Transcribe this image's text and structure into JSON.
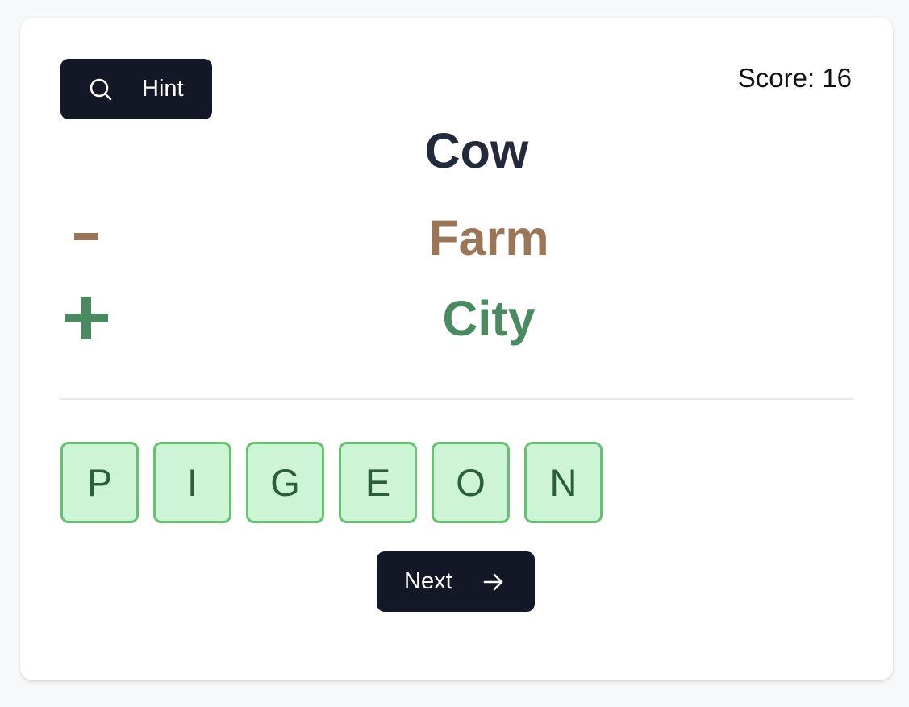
{
  "hint": {
    "label": "Hint",
    "icon": "search-icon"
  },
  "score": {
    "text": "Score: 16"
  },
  "puzzle": {
    "base_word": "Cow",
    "minus": {
      "sign": "-",
      "word": "Farm",
      "color": "#9a7657"
    },
    "plus": {
      "sign": "+",
      "word": "City",
      "color": "#4a8a60"
    }
  },
  "answer": {
    "letters": [
      "P",
      "I",
      "G",
      "E",
      "O",
      "N"
    ],
    "tile_fill": "#cdf5d5",
    "tile_border": "#66c172",
    "letter_color": "#2c5f37"
  },
  "next": {
    "label": "Next",
    "icon": "arrow-right-icon"
  },
  "colors": {
    "button_bg": "#131726",
    "heading": "#222a3b"
  }
}
